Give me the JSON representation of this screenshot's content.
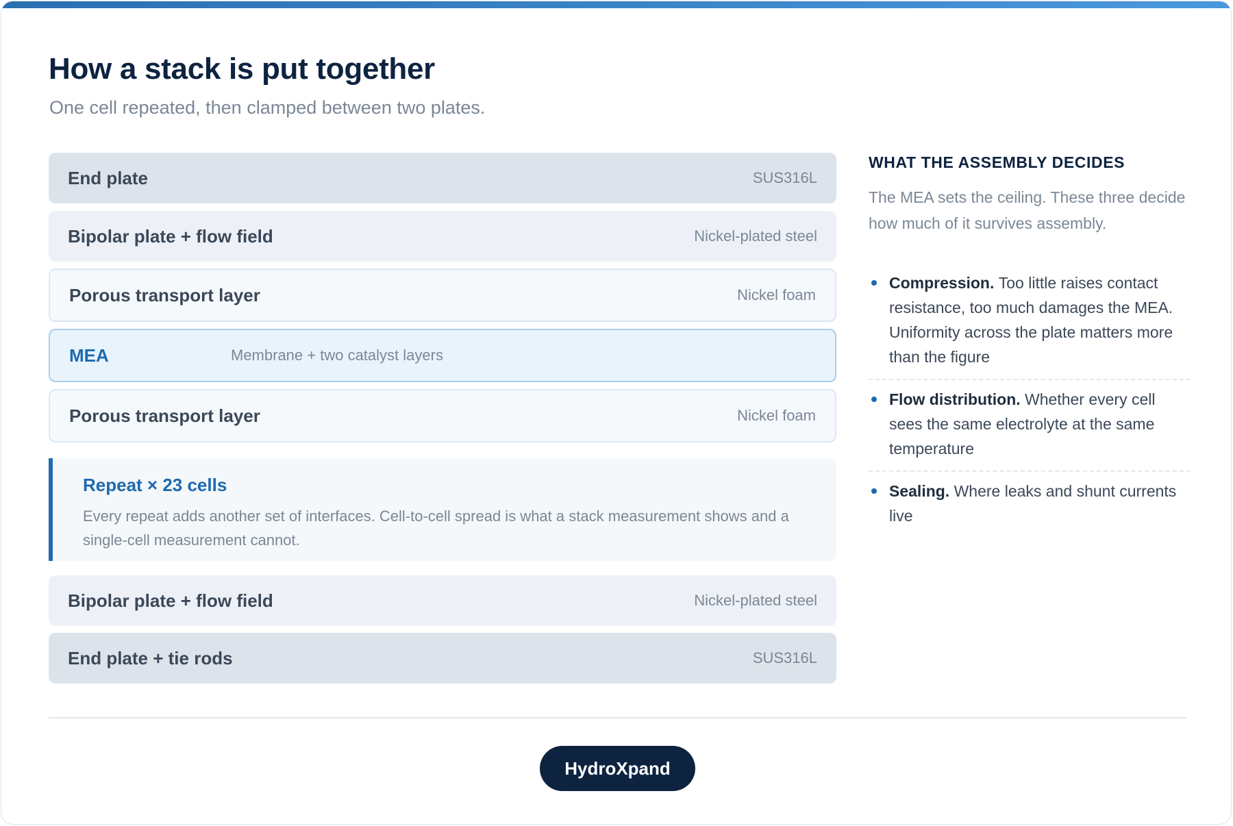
{
  "header": {
    "title": "How a stack is put together",
    "subtitle": "One cell repeated, then clamped between two plates."
  },
  "stack": {
    "layers": [
      {
        "name": "End plate",
        "material": "SUS316L"
      },
      {
        "name": "Bipolar plate + flow field",
        "material": "Nickel-plated steel"
      },
      {
        "name": "Porous transport layer",
        "material": "Nickel foam"
      },
      {
        "name": "MEA",
        "material": "Membrane + two catalyst layers"
      },
      {
        "name": "Porous transport layer",
        "material": "Nickel foam"
      },
      {
        "name": "Bipolar plate + flow field",
        "material": "Nickel-plated steel"
      },
      {
        "name": "End plate + tie rods",
        "material": "SUS316L"
      }
    ],
    "repeat": {
      "title": "Repeat × 23 cells",
      "text": "Every repeat adds another set of interfaces. Cell-to-cell spread is what a stack measurement shows and a single-cell measurement cannot."
    }
  },
  "sidebar": {
    "title": "WHAT THE ASSEMBLY DECIDES",
    "intro": "The MEA sets the ceiling. These three decide how much of it survives assembly.",
    "points": [
      {
        "lead": "Compression.",
        "text": "Too little raises contact resistance, too much damages the MEA. Uniformity across the plate matters more than the figure"
      },
      {
        "lead": "Flow distribution.",
        "text": "Whether every cell sees the same electrolyte at the same temperature"
      },
      {
        "lead": "Sealing.",
        "text": "Where leaks and shunt currents live"
      }
    ]
  },
  "footer": {
    "brand": "HydroXpand"
  },
  "colors": {
    "accent": "#1e6aaf",
    "navy": "#0d2340",
    "muted": "#7b8795"
  }
}
